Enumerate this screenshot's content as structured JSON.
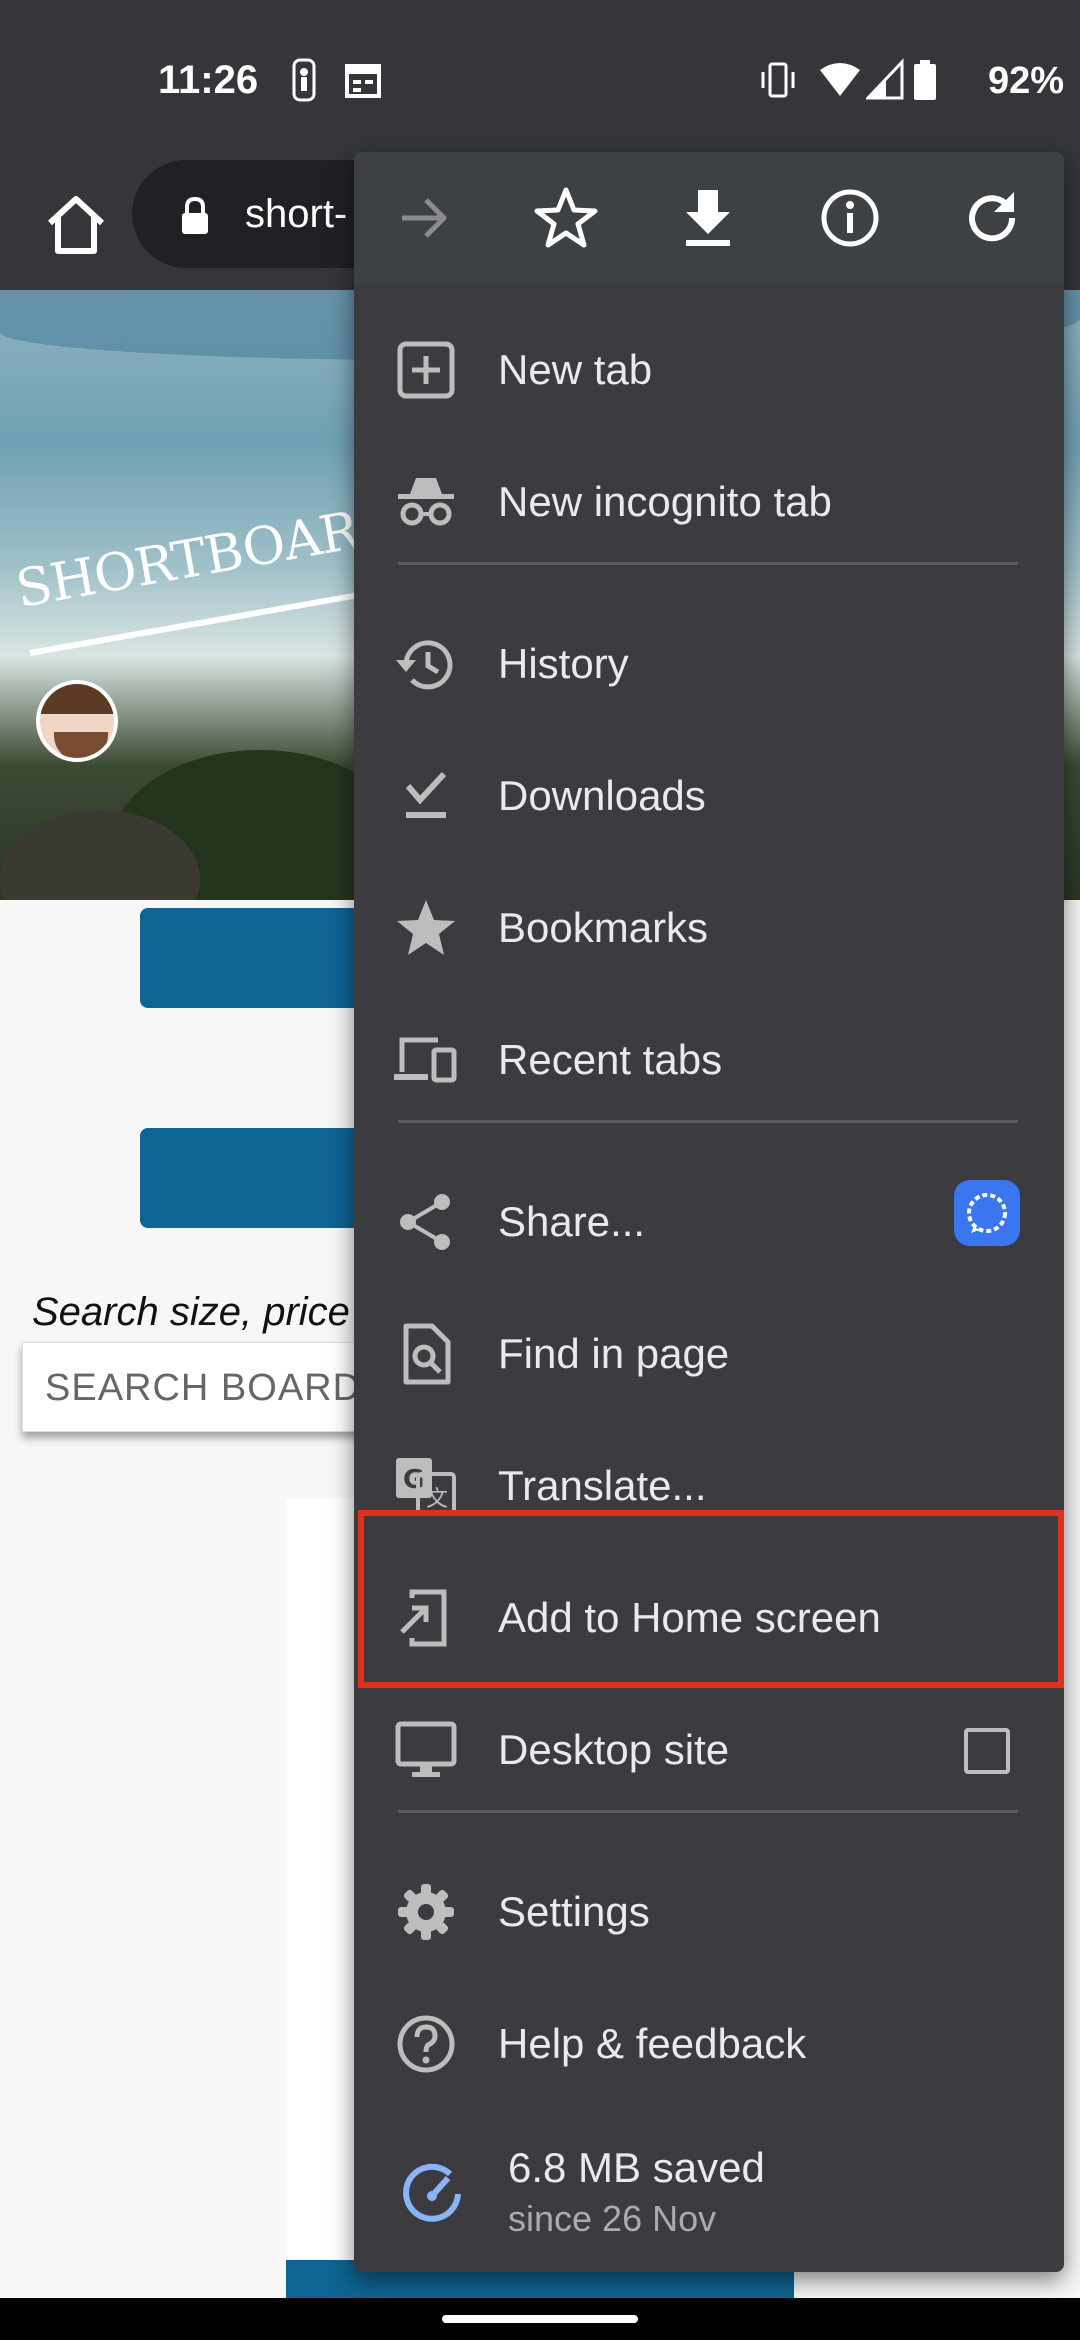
{
  "status_bar": {
    "time": "11:26",
    "battery": "92%",
    "icons": [
      "nba-icon",
      "calendar-icon",
      "vibrate-icon",
      "wifi-icon",
      "cell-signal-icon",
      "battery-icon"
    ]
  },
  "toolbar": {
    "url": "short-"
  },
  "page": {
    "logo": "SHORTBOARD.COM",
    "search_hint": "Search size, price",
    "search_placeholder": "SEARCH BOARDS"
  },
  "menu": {
    "top_icons": [
      "forward-icon",
      "star-icon",
      "download-icon",
      "info-icon",
      "refresh-icon"
    ],
    "items": [
      {
        "label": "New tab",
        "icon": "new-tab-icon"
      },
      {
        "label": "New incognito tab",
        "icon": "incognito-icon"
      },
      {
        "label": "History",
        "icon": "history-icon"
      },
      {
        "label": "Downloads",
        "icon": "downloads-icon"
      },
      {
        "label": "Bookmarks",
        "icon": "bookmarks-star-icon"
      },
      {
        "label": "Recent tabs",
        "icon": "recent-tabs-icon"
      },
      {
        "label": "Share...",
        "icon": "share-icon"
      },
      {
        "label": "Find in page",
        "icon": "find-in-page-icon"
      },
      {
        "label": "Translate...",
        "icon": "translate-icon"
      },
      {
        "label": "Add to Home screen",
        "icon": "add-to-home-icon"
      },
      {
        "label": "Desktop site",
        "icon": "desktop-icon"
      },
      {
        "label": "Settings",
        "icon": "settings-gear-icon"
      },
      {
        "label": "Help & feedback",
        "icon": "help-icon"
      }
    ],
    "data_saver": {
      "main": "6.8 MB saved",
      "sub": "since 26 Nov"
    },
    "desktop_site_checked": false,
    "highlight_color": "#e0311c"
  }
}
